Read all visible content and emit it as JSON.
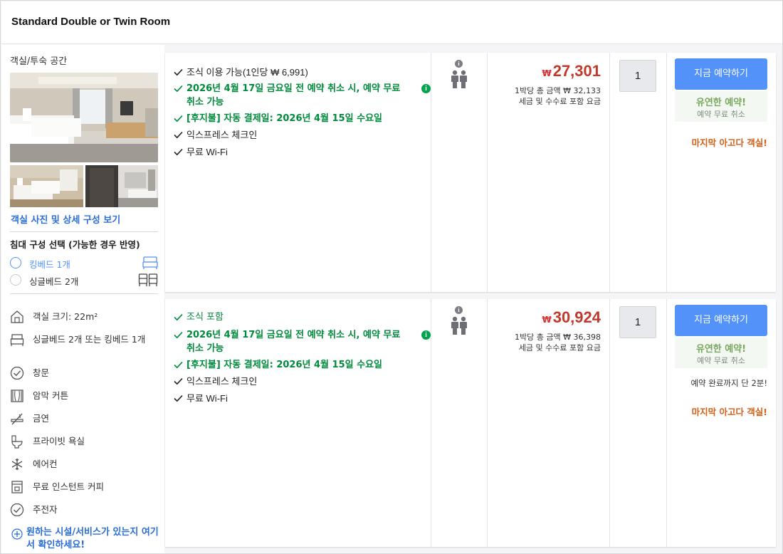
{
  "room": {
    "title": "Standard Double or Twin Room"
  },
  "left": {
    "space_label": "객실/투숙 공간",
    "see_photos": "객실 사진 및 상세 구성 보기",
    "bed_title": "침대 구성 선택 (가능한 경우 반영)",
    "bed_options": [
      {
        "label": "킹베드 1개",
        "selected": true,
        "icon": "double-bed-icon"
      },
      {
        "label": "싱글베드 2개",
        "selected": false,
        "icon": "twin-beds-icon"
      }
    ],
    "amenities": [
      {
        "icon": "room-size-icon",
        "label": "객실 크기: 22m²"
      },
      {
        "icon": "bed-icon",
        "label": "싱글베드 2개 또는 킹베드 1개"
      },
      {
        "icon": "window-check-icon",
        "label": "창문"
      },
      {
        "icon": "blackout-curtain-icon",
        "label": "암막 커튼"
      },
      {
        "icon": "no-smoking-icon",
        "label": "금연"
      },
      {
        "icon": "private-bathroom-icon",
        "label": "프라이빗 욕실"
      },
      {
        "icon": "air-conditioner-icon",
        "label": "에어컨"
      },
      {
        "icon": "coffee-maker-icon",
        "label": "무료 인스턴트 커피"
      },
      {
        "icon": "kettle-check-icon",
        "label": "주전자"
      }
    ],
    "more_link": "원하는 시설/서비스가 있는지 여기서 확인하세요!"
  },
  "offers": [
    {
      "features": [
        {
          "text": "조식 이용 가능(1인당 ₩ 6,991)",
          "style": "plain",
          "info": false
        },
        {
          "text": "2026년 4월 17일 금요일 전 예약 취소 시, 예약 무료 취소 가능",
          "style": "green",
          "info": true
        },
        {
          "text": "[후지불] 자동 결제일: 2026년 4월 15일 수요일",
          "style": "green",
          "info": false
        },
        {
          "text": "익스프레스 체크인",
          "style": "plain",
          "info": false
        },
        {
          "text": "무료 Wi-Fi",
          "style": "plain",
          "info": false
        }
      ],
      "currency": "₩",
      "price": "27,301",
      "total_line": "1박당 총 금액 ₩ 32,133",
      "tax_line": "세금 및 수수료 포함 요금",
      "quantity": "1",
      "book_label": "지금 예약하기",
      "flex_title": "유연한 예약!",
      "flex_sub": "예약 무료 취소",
      "urgency": "",
      "last_room": "마지막 아고다 객실!"
    },
    {
      "features": [
        {
          "text": "조식 포함",
          "style": "green",
          "info": false
        },
        {
          "text": "2026년 4월 17일 금요일 전 예약 취소 시, 예약 무료 취소 가능",
          "style": "green",
          "info": true
        },
        {
          "text": "[후지불] 자동 결제일: 2026년 4월 15일 수요일",
          "style": "green",
          "info": false
        },
        {
          "text": "익스프레스 체크인",
          "style": "plain",
          "info": false
        },
        {
          "text": "무료 Wi-Fi",
          "style": "plain",
          "info": false
        }
      ],
      "currency": "₩",
      "price": "30,924",
      "total_line": "1박당 총 금액 ₩ 36,398",
      "tax_line": "세금 및 수수료 포함 요금",
      "quantity": "1",
      "book_label": "지금 예약하기",
      "flex_title": "유연한 예약!",
      "flex_sub": "예약 무료 취소",
      "urgency": "예약 완료까지 단 2분!",
      "last_room": "마지막 아고다 객실!"
    }
  ]
}
